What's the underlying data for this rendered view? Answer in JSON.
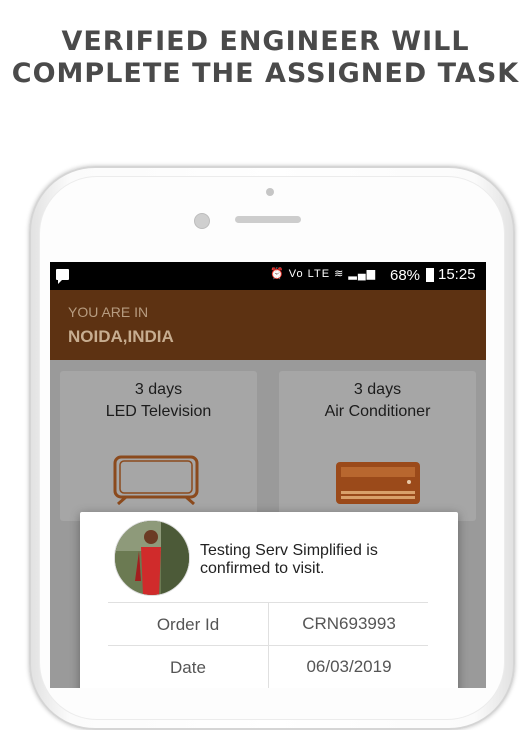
{
  "headline": {
    "line1": "VERIFIED ENGINEER WILL",
    "line2": "COMPLETE THE ASSIGNED TASK"
  },
  "status_bar": {
    "notification_icon": "message-icon",
    "network_text": "Vo LTE",
    "battery": "68%",
    "time": "15:25"
  },
  "location": {
    "label": "YOU ARE IN",
    "value": "NOIDA,INDIA"
  },
  "services": [
    {
      "days": "3 days",
      "name": "LED Television",
      "icon": "tv-icon"
    },
    {
      "days": "3 days",
      "name": "Air Conditioner",
      "icon": "ac-icon"
    }
  ],
  "dialog": {
    "message": "Testing Serv Simplified is confirmed to visit.",
    "rows": [
      {
        "label": "Order Id",
        "value": "CRN693993"
      },
      {
        "label": "Date",
        "value": "06/03/2019"
      }
    ]
  },
  "colors": {
    "location_bar": "#5d3212",
    "accent_brown": "#9b4a1a",
    "overlay_gray": "#9a9a9a"
  }
}
